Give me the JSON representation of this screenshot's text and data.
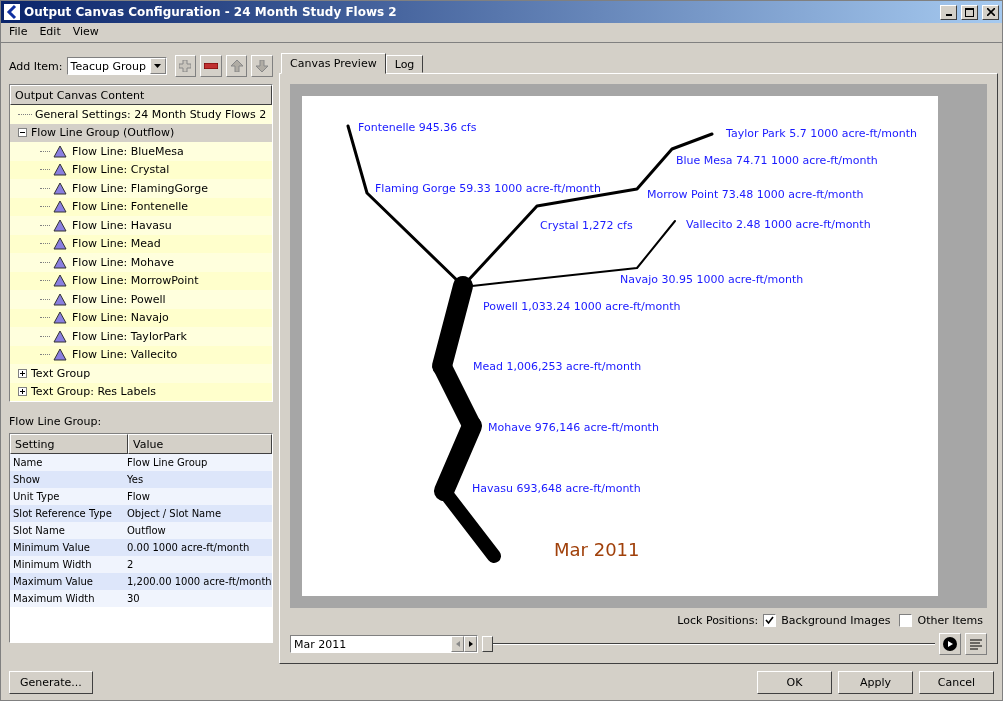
{
  "window": {
    "title": "Output Canvas Configuration - 24 Month Study Flows 2"
  },
  "menu": [
    "File",
    "Edit",
    "View"
  ],
  "add_item": {
    "label": "Add Item:",
    "value": "Teacup Group"
  },
  "tree": {
    "header": "Output Canvas Content",
    "items": [
      {
        "label": "General Settings: 24 Month Study Flows 2",
        "selected": false
      },
      {
        "label": "Flow Line Group (Outflow)",
        "selected": true,
        "expanded": true,
        "children": [
          {
            "label": "Flow Line: BlueMesa",
            "selected": false
          },
          {
            "label": "Flow Line: Crystal",
            "selected": false
          },
          {
            "label": "Flow Line: FlamingGorge",
            "selected": false
          },
          {
            "label": "Flow Line: Fontenelle",
            "selected": false
          },
          {
            "label": "Flow Line: Havasu",
            "selected": false
          },
          {
            "label": "Flow Line: Mead",
            "selected": false
          },
          {
            "label": "Flow Line: Mohave",
            "selected": false
          },
          {
            "label": "Flow Line: MorrowPoint",
            "selected": false
          },
          {
            "label": "Flow Line: Powell",
            "selected": false
          },
          {
            "label": "Flow Line: Navajo",
            "selected": false
          },
          {
            "label": "Flow Line: TaylorPark",
            "selected": false
          },
          {
            "label": "Flow Line: Vallecito",
            "selected": false
          }
        ]
      },
      {
        "label": "Text Group",
        "selected": false,
        "expanded": false
      },
      {
        "label": "Text Group: Res Labels",
        "selected": false,
        "expanded": false
      }
    ]
  },
  "settings": {
    "title": "Flow Line Group:",
    "columns": [
      "Setting",
      "Value"
    ],
    "rows": [
      [
        "Name",
        "Flow Line Group"
      ],
      [
        "Show",
        "Yes"
      ],
      [
        "Unit Type",
        "Flow"
      ],
      [
        "Slot Reference Type",
        "Object / Slot Name"
      ],
      [
        "Slot Name",
        "Outflow"
      ],
      [
        "Minimum Value",
        "0.00 1000 acre-ft/month"
      ],
      [
        "Minimum Width",
        "2"
      ],
      [
        "Maximum Value",
        "1,200.00 1000 acre-ft/month"
      ],
      [
        "Maximum Width",
        "30"
      ]
    ]
  },
  "tabs": [
    {
      "label": "Canvas Preview",
      "selected": true
    },
    {
      "label": "Log",
      "selected": false
    }
  ],
  "canvas": {
    "labels": [
      "Fontenelle 945.36 cfs",
      "Taylor Park 5.7 1000 acre-ft/month",
      "Blue Mesa 74.71 1000 acre-ft/month",
      "Flaming Gorge 59.33 1000 acre-ft/month",
      "Morrow Point 73.48 1000 acre-ft/month",
      "Crystal 1,272 cfs",
      "Vallecito 2.48 1000 acre-ft/month",
      "Navajo 30.95 1000 acre-ft/month",
      "Powell 1,033.24 1000 acre-ft/month",
      "Mead 1,006,253 acre-ft/month",
      "Mohave 976,146 acre-ft/month",
      "Havasu 693,648 acre-ft/month"
    ],
    "date": "Mar 2011"
  },
  "lock": {
    "label": "Lock Positions:",
    "options": [
      {
        "label": "Background Images",
        "checked": true
      },
      {
        "label": "Other Items",
        "checked": false
      }
    ]
  },
  "timestep": {
    "value": "Mar 2011",
    "level": 0
  },
  "buttons": {
    "generate": "Generate...",
    "ok": "OK",
    "apply": "Apply",
    "cancel": "Cancel"
  }
}
